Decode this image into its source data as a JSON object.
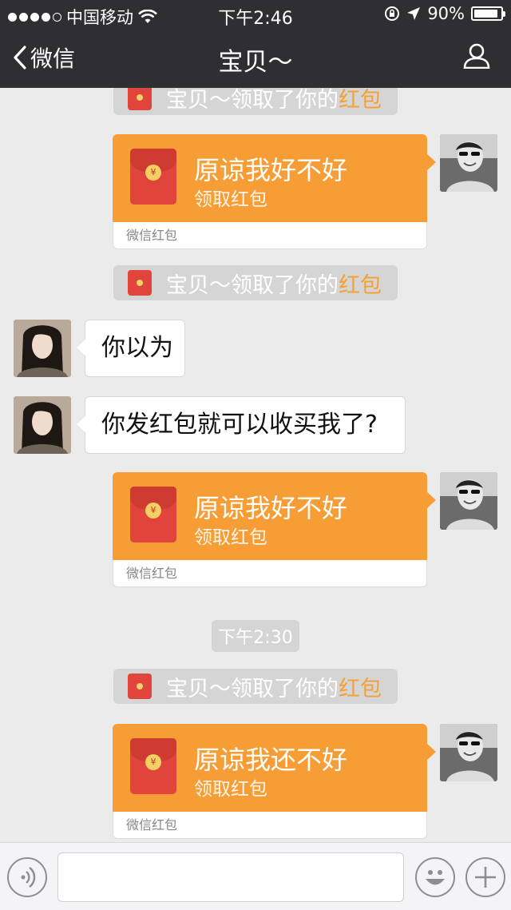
{
  "status_bar": {
    "carrier": "中国移动",
    "time": "下午2:46",
    "battery": "90%",
    "battery_level": 0.9
  },
  "nav": {
    "back_label": "微信",
    "title": "宝贝～"
  },
  "messages": {
    "sys1": {
      "prefix": "宝贝～领取了你的",
      "highlight": "红包"
    },
    "rp1": {
      "text": "原谅我好不好",
      "action": "领取红包",
      "footer": "微信红包"
    },
    "sys2": {
      "prefix": "宝贝～领取了你的",
      "highlight": "红包"
    },
    "msg1": {
      "text": "你以为"
    },
    "msg2": {
      "text": "你发红包就可以收买我了?"
    },
    "rp2": {
      "text": "原谅我好不好",
      "action": "领取红包",
      "footer": "微信红包"
    },
    "time_label": "下午2:30",
    "sys3": {
      "prefix": "宝贝～领取了你的",
      "highlight": "红包"
    },
    "rp3": {
      "text": "原谅我还不好",
      "action": "领取红包",
      "footer": "微信红包"
    }
  },
  "colors": {
    "accent": "#f79d35",
    "envelope": "#e0443a",
    "nav_bg": "#2e2e33"
  },
  "input_bar": {
    "voice_icon": "voice-icon",
    "emoji_icon": "emoji-icon",
    "plus_icon": "plus-icon"
  }
}
